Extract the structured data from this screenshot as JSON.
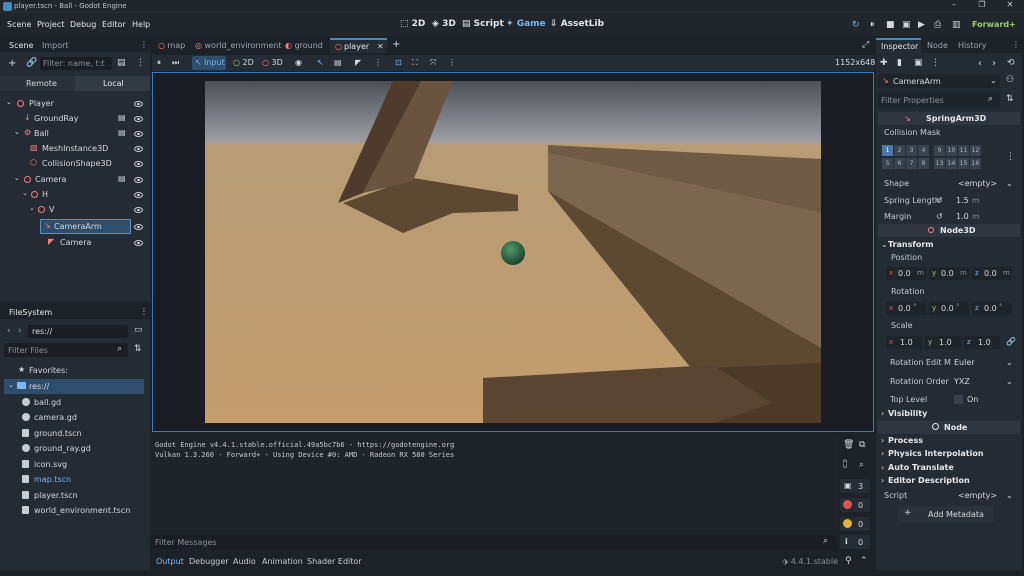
{
  "window": {
    "title": "player.tscn - Ball - Godot Engine"
  },
  "menu": {
    "items": [
      "Scene",
      "Project",
      "Debug",
      "Editor",
      "Help"
    ]
  },
  "modes": {
    "m2d": "2D",
    "m3d": "3D",
    "script": "Script",
    "game": "Game",
    "assetlib": "AssetLib"
  },
  "renderer": "Forward+",
  "scene_dock": {
    "tabs": [
      "Scene",
      "Import"
    ],
    "filter_placeholder": "Filter: name, t:t",
    "remote": "Remote",
    "local": "Local",
    "nodes": [
      "Player",
      "GroundRay",
      "Ball",
      "MeshInstance3D",
      "CollisionShape3D",
      "Camera",
      "H",
      "V",
      "CameraArm",
      "Camera"
    ]
  },
  "filesystem": {
    "title": "FileSystem",
    "path": "res://",
    "filter_placeholder": "Filter Files",
    "favorites": "Favorites:",
    "root": "res://",
    "files": [
      "ball.gd",
      "camera.gd",
      "ground.tscn",
      "ground_ray.gd",
      "icon.svg",
      "map.tscn",
      "player.tscn",
      "world_environment.tscn"
    ]
  },
  "editor_tabs": [
    "map",
    "world_environment",
    "ground",
    "player"
  ],
  "game_toolbar": {
    "input": "Input",
    "d2": "2D",
    "d3": "3D",
    "resolution": "1152x648"
  },
  "console": {
    "lines": [
      "Godot Engine v4.4.1.stable.official.49a5bc7b6 - https://godotengine.org",
      "Vulkan 1.3.260 - Forward+ - Using Device #0: AMD - Radeon RX 580 Series"
    ],
    "filter_placeholder": "Filter Messages",
    "counts": [
      "3",
      "0",
      "0",
      "0"
    ]
  },
  "bottom_tabs": [
    "Output",
    "Debugger",
    "Audio",
    "Animation",
    "Shader Editor"
  ],
  "version": "4.4.1.stable",
  "inspector": {
    "tabs": [
      "Inspector",
      "Node",
      "History"
    ],
    "object": "CameraArm",
    "filter_placeholder": "Filter Properties",
    "class_header": "SpringArm3D",
    "collision_mask": "Collision Mask",
    "layers": [
      "1",
      "2",
      "3",
      "4",
      "9",
      "10",
      "11",
      "12",
      "5",
      "6",
      "7",
      "8",
      "13",
      "14",
      "15",
      "16"
    ],
    "shape_label": "Shape",
    "shape_value": "<empty>",
    "spring_length_label": "Spring Length",
    "spring_length_value": "1.5",
    "unit_m": "m",
    "margin_label": "Margin",
    "margin_value": "1.0",
    "node3d_header": "Node3D",
    "transform": "Transform",
    "position": "Position",
    "rotation": "Rotation",
    "scale": "Scale",
    "x": "x",
    "y": "y",
    "z": "z",
    "pos_values": [
      "0.0",
      "0.0",
      "0.0"
    ],
    "rot_values": [
      "0.0",
      "0.0",
      "0.0"
    ],
    "deg": "°",
    "scale_values": [
      "1.0",
      "1.0",
      "1.0"
    ],
    "rotation_edit_label": "Rotation Edit M",
    "rotation_edit_value": "Euler",
    "rotation_order_label": "Rotation Order",
    "rotation_order_value": "YXZ",
    "top_level_label": "Top Level",
    "top_level_value": "On",
    "visibility": "Visibility",
    "node_header": "Node",
    "process": "Process",
    "physics_interp": "Physics Interpolation",
    "auto_translate": "Auto Translate",
    "editor_description": "Editor Description",
    "script_label": "Script",
    "script_value": "<empty>",
    "add_metadata": "Add Metadata"
  },
  "colors": {
    "accent": "#478cbf",
    "node3d": "#fc7f7f",
    "bg": "#1d2229",
    "panel": "#252b33"
  }
}
